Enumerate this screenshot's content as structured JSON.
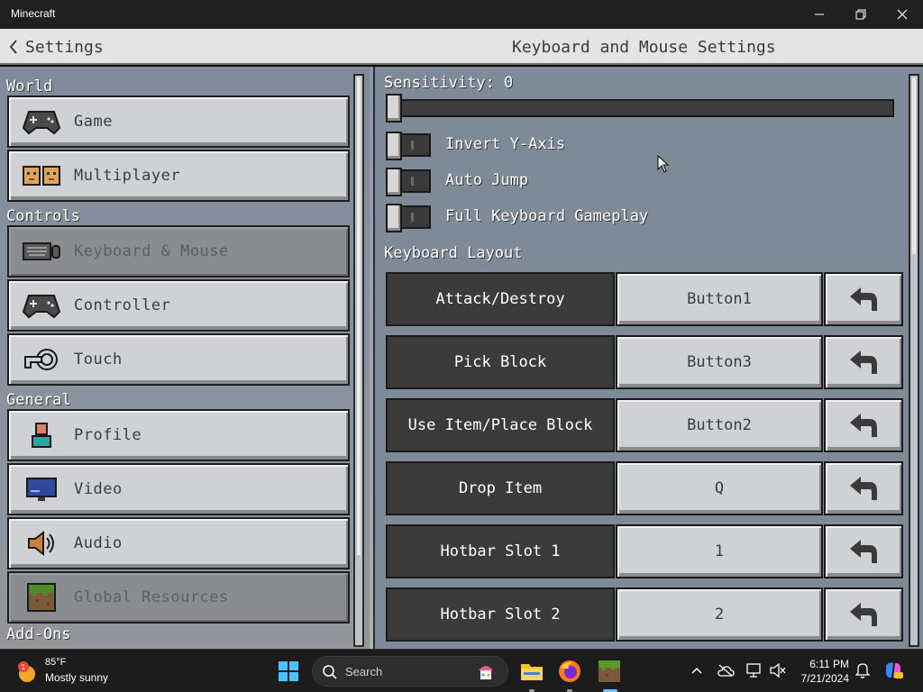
{
  "window": {
    "title": "Minecraft"
  },
  "header": {
    "back_label": "Settings",
    "page_title": "Keyboard and Mouse Settings"
  },
  "sidebar": {
    "sections": [
      {
        "label": "World",
        "items": [
          {
            "label": "Game",
            "icon": "controller-icon",
            "state": "normal"
          },
          {
            "label": "Multiplayer",
            "icon": "multiplayer-icon",
            "state": "normal"
          }
        ]
      },
      {
        "label": "Controls",
        "items": [
          {
            "label": "Keyboard & Mouse",
            "icon": "keyboard-icon",
            "state": "active"
          },
          {
            "label": "Controller",
            "icon": "controller-icon",
            "state": "normal"
          },
          {
            "label": "Touch",
            "icon": "touch-icon",
            "state": "normal"
          }
        ]
      },
      {
        "label": "General",
        "items": [
          {
            "label": "Profile",
            "icon": "profile-icon",
            "state": "normal"
          },
          {
            "label": "Video",
            "icon": "monitor-icon",
            "state": "normal"
          },
          {
            "label": "Audio",
            "icon": "speaker-icon",
            "state": "normal"
          },
          {
            "label": "Global Resources",
            "icon": "grass-block-icon",
            "state": "disabled"
          }
        ]
      },
      {
        "label": "Add-Ons",
        "items": []
      }
    ]
  },
  "settings": {
    "sensitivity_label": "Sensitivity: 0",
    "sensitivity_value": 0,
    "toggles": [
      {
        "label": "Invert Y-Axis",
        "on": false
      },
      {
        "label": "Auto Jump",
        "on": false
      },
      {
        "label": "Full Keyboard Gameplay",
        "on": false
      }
    ],
    "keyboard_layout_title": "Keyboard Layout",
    "bindings": [
      {
        "action": "Attack/Destroy",
        "key": "Button1"
      },
      {
        "action": "Pick Block",
        "key": "Button3"
      },
      {
        "action": "Use Item/Place Block",
        "key": "Button2"
      },
      {
        "action": "Drop Item",
        "key": "Q"
      },
      {
        "action": "Hotbar Slot 1",
        "key": "1"
      },
      {
        "action": "Hotbar Slot 2",
        "key": "2"
      }
    ]
  },
  "taskbar": {
    "weather": {
      "temp": "85°F",
      "condition": "Mostly sunny",
      "badge": "1"
    },
    "search_label": "Search",
    "clock": {
      "time": "6:11 PM",
      "date": "7/21/2024"
    }
  },
  "colors": {
    "panel_dark": "#3b3b3c",
    "button_light": "#d0d1d4",
    "background": "#8a95a3",
    "taskbar": "#1c1c1c"
  }
}
